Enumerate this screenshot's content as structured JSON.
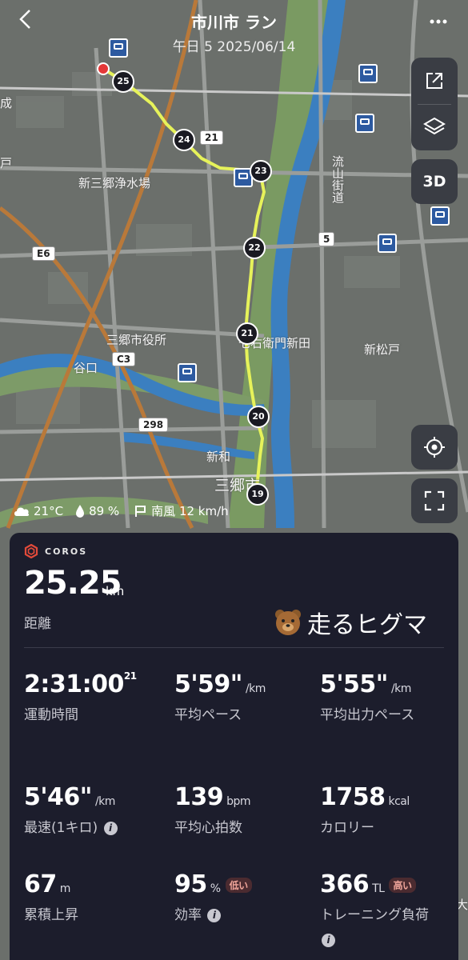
{
  "header": {
    "title": "市川市 ラン",
    "subtitle": "午日 5 2025/06/14",
    "back_icon": "chevron-left-icon",
    "more_icon": "more-icon"
  },
  "map": {
    "labels": [
      "新三郷浄水場",
      "三郷市役所",
      "谷口",
      "七右衛門新田",
      "新松戸",
      "新和",
      "三郷市",
      "流山街道",
      "成",
      "戸",
      "大"
    ],
    "road_numbers": [
      "E6",
      "C3",
      "21",
      "5",
      "298"
    ],
    "km_markers": [
      "25",
      "24",
      "23",
      "22",
      "21",
      "20",
      "19"
    ],
    "route_color": "#e6f25a",
    "river_color": "#3b7fc0"
  },
  "controls": {
    "share_icon": "share-icon",
    "layers_icon": "layers-icon",
    "btn_3d": "3D",
    "locate_icon": "locate-icon",
    "fullscreen_icon": "fullscreen-icon"
  },
  "weather": {
    "temp": "21°C",
    "humidity": "89 %",
    "wind": "南風 12 km/h"
  },
  "summary": {
    "brand": "COROS",
    "distance": "25.25",
    "distance_unit": "km",
    "distance_label": "距離",
    "user": "走るヒグマ",
    "metrics": [
      {
        "value": "2:31:00",
        "sup": "21",
        "unit": "",
        "label": "運動時間"
      },
      {
        "value": "5'59\"",
        "unit": "/km",
        "label": "平均ペース"
      },
      {
        "value": "5'55\"",
        "unit": "/km",
        "label": "平均出力ペース"
      },
      {
        "value": "5'46\"",
        "unit": "/km",
        "label": "最速(1キロ)"
      },
      {
        "value": "139",
        "unit": "bpm",
        "label": "平均心拍数"
      },
      {
        "value": "1758",
        "unit": "kcal",
        "label": "カロリー"
      },
      {
        "value": "67",
        "unit": "m",
        "label": "累積上昇"
      },
      {
        "value": "95",
        "unit": "%",
        "badge": "低い",
        "label": "効率"
      },
      {
        "value": "366",
        "unit": "TL",
        "badge": "高い",
        "label": "トレーニング負荷"
      }
    ]
  }
}
